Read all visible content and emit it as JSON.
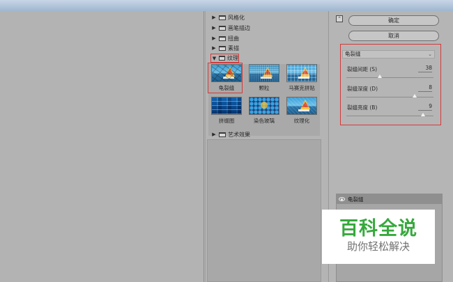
{
  "gallery": {
    "folders": [
      {
        "label": "风格化",
        "expanded": false
      },
      {
        "label": "画笔描边",
        "expanded": false
      },
      {
        "label": "扭曲",
        "expanded": false
      },
      {
        "label": "素描",
        "expanded": false
      },
      {
        "label": "纹理",
        "expanded": true
      },
      {
        "label": "艺术效果",
        "expanded": false
      }
    ],
    "texture_filters": [
      {
        "label": "龟裂缝",
        "selected": true
      },
      {
        "label": "颗粒",
        "selected": false
      },
      {
        "label": "马赛克拼贴",
        "selected": false
      },
      {
        "label": "拼缀图",
        "selected": false
      },
      {
        "label": "染色玻璃",
        "selected": false
      },
      {
        "label": "纹理化",
        "selected": false
      }
    ]
  },
  "actions": {
    "ok_label": "确定",
    "cancel_label": "取消"
  },
  "settings": {
    "selected_filter": "龟裂缝",
    "params": [
      {
        "label": "裂缝间距 (S)",
        "value": "38",
        "level": 0.38
      },
      {
        "label": "裂缝深度 (D)",
        "value": "8",
        "level": 0.8
      },
      {
        "label": "裂缝亮度 (B)",
        "value": "9",
        "level": 0.9
      }
    ]
  },
  "layers": {
    "items": [
      {
        "label": "龟裂缝",
        "visible": true
      }
    ]
  },
  "watermark": {
    "title": "百科全说",
    "subtitle": "助你轻松解决"
  },
  "colors": {
    "highlight_border": "#d33a3a",
    "watermark_green": "#36a93c"
  }
}
